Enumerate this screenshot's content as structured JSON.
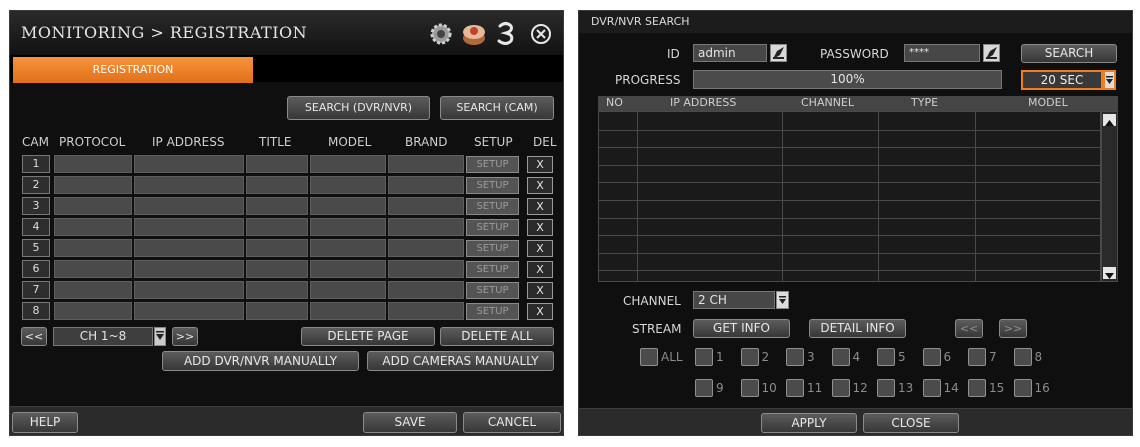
{
  "left": {
    "title": "MONITORING > REGISTRATION",
    "tab": "REGISTRATION",
    "search_dvr": "SEARCH (DVR/NVR)",
    "search_cam": "SEARCH (CAM)",
    "headers": [
      "CAM",
      "PROTOCOL",
      "IP ADDRESS",
      "TITLE",
      "MODEL",
      "BRAND",
      "SETUP",
      "DEL"
    ],
    "rows": [
      "1",
      "2",
      "3",
      "4",
      "5",
      "6",
      "7",
      "8"
    ],
    "setup_label": "SETUP",
    "del_label": "X",
    "prev": "<<",
    "next": ">>",
    "ch_select": "CH 1~8",
    "delete_page": "DELETE PAGE",
    "delete_all": "DELETE ALL",
    "add_dvr": "ADD DVR/NVR MANUALLY",
    "add_cam": "ADD CAMERAS MANUALLY",
    "help": "HELP",
    "save": "SAVE",
    "cancel": "CANCEL",
    "accent": "#f07d1e",
    "icons": [
      "settings-gear-icon",
      "record-drum-icon",
      "status-3-icon",
      "close-icon"
    ]
  },
  "right": {
    "title": "DVR/NVR SEARCH",
    "id_label": "ID",
    "id_value": "admin",
    "password_label": "PASSWORD",
    "password_value": "****",
    "search": "SEARCH",
    "progress_label": "PROGRESS",
    "progress_text": "100%",
    "progress_value": 100,
    "timeout": "20 SEC",
    "table_headers": [
      "NO",
      "IP ADDRESS",
      "CHANNEL",
      "TYPE",
      "MODEL"
    ],
    "channel_label": "CHANNEL",
    "channel_value": "2 CH",
    "stream_label": "STREAM",
    "get_info": "GET INFO",
    "detail_info": "DETAIL INFO",
    "prev": "<<",
    "next": ">>",
    "all_label": "ALL",
    "channels": [
      "1",
      "2",
      "3",
      "4",
      "5",
      "6",
      "7",
      "8",
      "9",
      "10",
      "11",
      "12",
      "13",
      "14",
      "15",
      "16"
    ],
    "apply": "APPLY",
    "close": "CLOSE"
  }
}
